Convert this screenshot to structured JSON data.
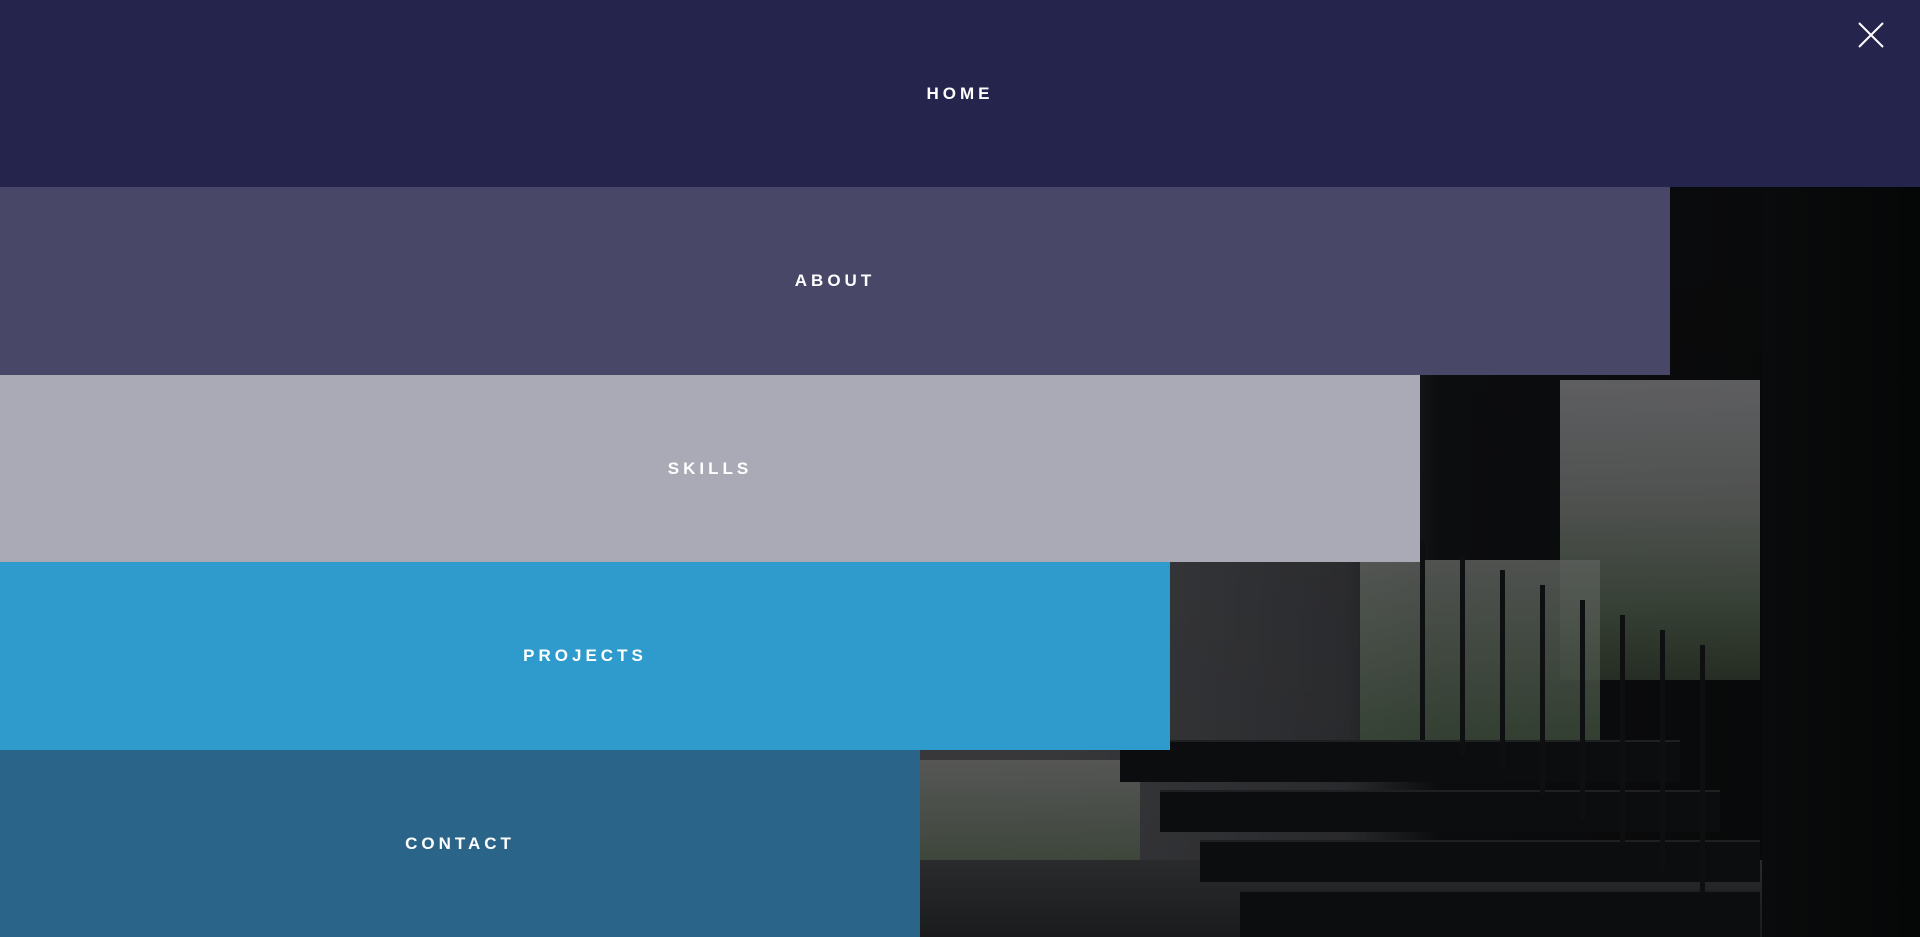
{
  "menu": {
    "items": [
      {
        "label": "HOME"
      },
      {
        "label": "ABOUT"
      },
      {
        "label": "SKILLS"
      },
      {
        "label": "PROJECTS"
      },
      {
        "label": "CONTACT"
      }
    ]
  },
  "close": {
    "icon": "close-icon"
  },
  "background": {
    "image": "staircase-photo"
  },
  "colors": {
    "home": "#25244d",
    "about": "#484768",
    "skills": "#a9aab6",
    "projects": "#2f9bcc",
    "contact": "#2b6489"
  }
}
